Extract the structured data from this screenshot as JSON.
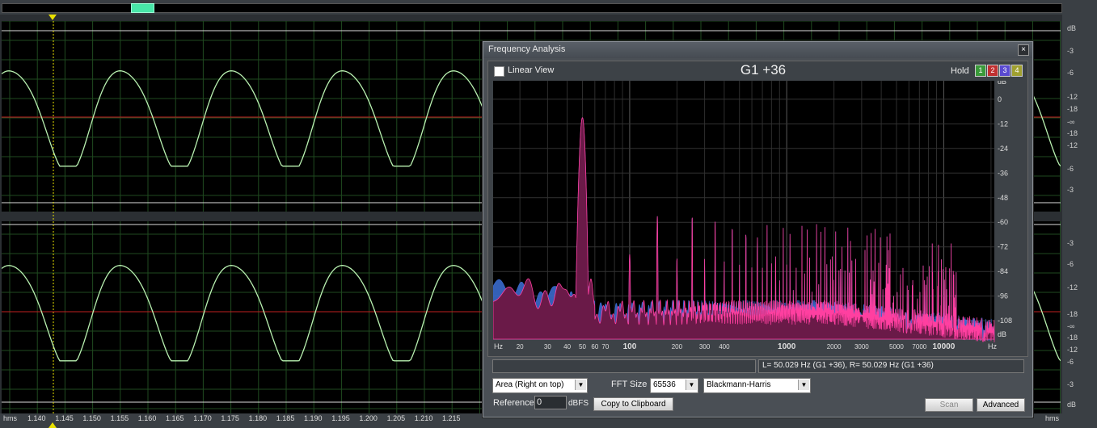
{
  "dialog": {
    "title": "Frequency Analysis",
    "close_label": "×",
    "linear_view_label": "Linear View",
    "linear_view_checked": false,
    "note_display": "G1 +36",
    "hold_label": "Hold",
    "hold_buttons": [
      {
        "label": "1",
        "color": "#3a9a3a"
      },
      {
        "label": "2",
        "color": "#c03030"
      },
      {
        "label": "3",
        "color": "#5a4ad0"
      },
      {
        "label": "4",
        "color": "#a0a030"
      }
    ],
    "status_left": "",
    "status_right": "L= 50.029 Hz (G1 +36), R= 50.029 Hz (G1 +36)",
    "display_mode": "Area (Right on top)",
    "fft_size_label": "FFT Size",
    "fft_size": "65536",
    "window_type": "Blackmann-Harris",
    "reference_label": "Reference",
    "reference_value": "0",
    "reference_unit": "dBFS",
    "copy_button": "Copy to Clipboard",
    "scan_button": "Scan",
    "advanced_button": "Advanced"
  },
  "spectrum": {
    "db_unit_label": "dB",
    "db_ticks": [
      "0",
      "-12",
      "-24",
      "-36",
      "-48",
      "-60",
      "-72",
      "-84",
      "-96",
      "-108"
    ],
    "hz_unit_label": "Hz",
    "freq_ticks": [
      "20",
      "30",
      "40",
      "50",
      "60",
      "70",
      "100",
      "200",
      "300",
      "400",
      "1000",
      "2000",
      "3000",
      "5000",
      "7000",
      "10000"
    ],
    "colors": {
      "left": "#ff3fa0",
      "right": "#3a6acc",
      "fill": "#6a1a48"
    }
  },
  "waveform": {
    "right_scale_top": [
      "dB",
      "-3",
      "-6",
      "-12",
      "-18",
      "-∞",
      "-18",
      "-12",
      "-6",
      "-3"
    ],
    "right_scale_bottom": [
      "-3",
      "-6",
      "-12",
      "-18",
      "-∞",
      "-18",
      "-12",
      "-6",
      "-3",
      "dB"
    ],
    "time_unit": "hms",
    "time_ticks": [
      "1.140",
      "1.145",
      "1.150",
      "1.155",
      "1.160",
      "1.165",
      "1.170",
      "1.175",
      "1.180",
      "1.185",
      "1.190",
      "1.195",
      "1.200",
      "1.205",
      "1.210",
      "1.215"
    ],
    "colors": {
      "wave": "#b8f0b0",
      "center_line": "#c02020",
      "grid": "#1f4a1f"
    }
  }
}
